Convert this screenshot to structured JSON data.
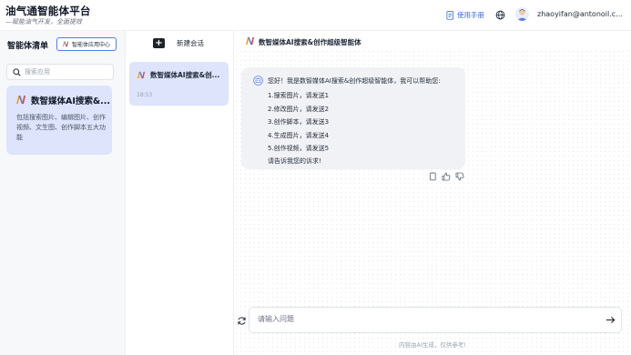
{
  "header": {
    "title": "油气通智能体平台",
    "subtitle": "—赋能油气开发，全面提效",
    "manual_label": "使用手册",
    "user_name": "zhaoyifan@antonoil.c..."
  },
  "sidebar": {
    "title": "智能体清单",
    "app_center_label": "智能体应用中心",
    "search_placeholder": "搜索应用",
    "agent": {
      "name": "数智媒体AI搜索&...",
      "description": "包括搜索图片、编辑图片、创作视频、文生图、创作脚本五大功能"
    }
  },
  "sessions": {
    "new_label": "新建会话",
    "items": [
      {
        "title": "数智媒体AI搜索&创...",
        "time": "18:53"
      }
    ]
  },
  "chat": {
    "title": "数智媒体AI搜索&创作超级智能体",
    "greeting": "您好！我是数智媒体AI搜索&创作超级智能体，我可以帮助您:",
    "options": [
      "1.搜索图片，请发送1",
      "2.修改图片，请发送2",
      "3.创作脚本，请发送3",
      "4.生成图片，请发送4",
      "5.创作视频，请发送5"
    ],
    "prompt": "请告诉我您的诉求!",
    "input_placeholder": "请输入问题",
    "disclaimer": "内容由AI生成，仅供参考!"
  },
  "icons": {
    "logo": "brand-n-logo-icon",
    "manual": "document-icon",
    "language": "globe-icon",
    "search": "search-icon",
    "bot": "robot-icon",
    "copy": "copy-icon",
    "like": "thumbs-up-icon",
    "dislike": "thumbs-down-icon",
    "refresh": "refresh-icon",
    "send": "send-arrow-icon"
  },
  "colors": {
    "accent": "#4f7cf0",
    "selected_bg": "#dde4fb",
    "link": "#3b6bd8"
  }
}
